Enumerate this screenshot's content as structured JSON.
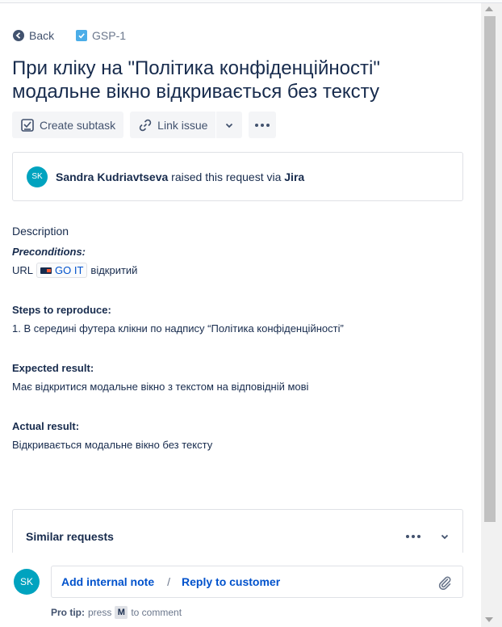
{
  "nav": {
    "back_label": "Back",
    "issue_key": "GSP-1"
  },
  "issue": {
    "title": "При кліку на \"Політика конфіденційності\" модальне вікно відкривається без тексту"
  },
  "toolbar": {
    "create_subtask_label": "Create subtask",
    "link_issue_label": "Link issue"
  },
  "raised": {
    "avatar_initials": "SK",
    "reporter": "Sandra Kudriavtseva",
    "middle_text": " raised this request via ",
    "channel": "Jira"
  },
  "description": {
    "label": "Description",
    "preconditions_heading": "Preconditions:",
    "url_prefix": "URL",
    "url_chip": "GO IT",
    "url_suffix": "відкритий",
    "steps_heading": "Steps to reproduce:",
    "steps_text": "1. В середині футера клікни по надпису “Політика конфіденційності”",
    "expected_heading": "Expected result:",
    "expected_text": "Має відкритися модальне вікно з текстом на відповідній мові",
    "actual_heading": "Actual result:",
    "actual_text": "Відкривається модальне вікно без тексту"
  },
  "similar": {
    "title": "Similar requests"
  },
  "comment": {
    "avatar_initials": "SK",
    "internal_note_label": "Add internal note",
    "separator": "/",
    "reply_label": "Reply to customer",
    "protip_label": "Pro tip:",
    "protip_press": "press",
    "protip_key": "M",
    "protip_suffix": "to comment"
  },
  "colors": {
    "link": "#0052cc",
    "text": "#172b4d",
    "avatar": "#00a3bf"
  }
}
